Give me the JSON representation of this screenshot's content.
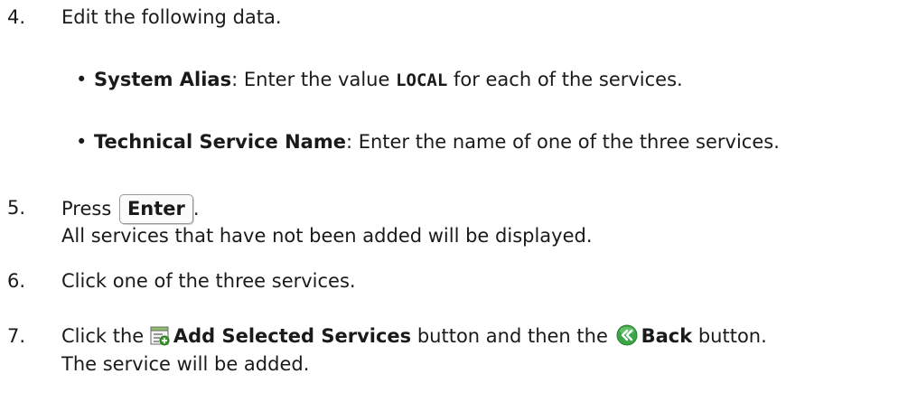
{
  "steps": [
    {
      "number": "4.",
      "text": "Edit the following data.",
      "bullets": [
        {
          "label": "System Alias",
          "text_before": ": Enter the value ",
          "code": "LOCAL",
          "text_after": " for each of the services."
        },
        {
          "label": "Technical Service Name",
          "text": ": Enter the name of one of the three services."
        }
      ]
    },
    {
      "number": "5.",
      "text_before": "Press ",
      "key": "Enter",
      "text_after": ".",
      "result": "All services that have not been added will be displayed."
    },
    {
      "number": "6.",
      "text": "Click one of the three services."
    },
    {
      "number": "7.",
      "text_1": "Click the ",
      "button_1": "Add Selected Services",
      "icon_1": "add-selected-services-icon",
      "text_2": " button and then the ",
      "button_2": "Back",
      "icon_2": "back-icon",
      "text_3": " button.",
      "result": "The service will be added."
    }
  ],
  "colors": {
    "text": "#1a1a1a",
    "back_icon_green": "#3aa646",
    "add_icon_green": "#3e9b2f"
  }
}
